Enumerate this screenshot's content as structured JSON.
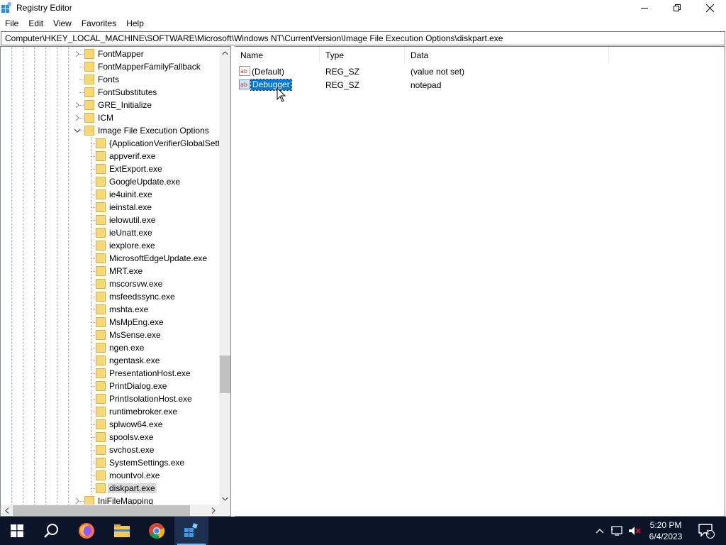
{
  "window": {
    "title": "Registry Editor",
    "controls": {
      "minimize": "minimize",
      "maximize": "maximize",
      "close": "close"
    }
  },
  "menu": [
    "File",
    "Edit",
    "View",
    "Favorites",
    "Help"
  ],
  "address": "Computer\\HKEY_LOCAL_MACHINE\\SOFTWARE\\Microsoft\\Windows NT\\CurrentVersion\\Image File Execution Options\\diskpart.exe",
  "tree": {
    "nodes": [
      {
        "label": "FontMapper",
        "level": 1,
        "expander": "collapsed"
      },
      {
        "label": "FontMapperFamilyFallback",
        "level": 1,
        "expander": "none"
      },
      {
        "label": "Fonts",
        "level": 1,
        "expander": "none"
      },
      {
        "label": "FontSubstitutes",
        "level": 1,
        "expander": "none"
      },
      {
        "label": "GRE_Initialize",
        "level": 1,
        "expander": "collapsed"
      },
      {
        "label": "ICM",
        "level": 1,
        "expander": "collapsed"
      },
      {
        "label": "Image File Execution Options",
        "level": 1,
        "expander": "expanded"
      },
      {
        "label": "{ApplicationVerifierGlobalSett",
        "level": 2,
        "expander": "none"
      },
      {
        "label": "appverif.exe",
        "level": 2,
        "expander": "none"
      },
      {
        "label": "ExtExport.exe",
        "level": 2,
        "expander": "none"
      },
      {
        "label": "GoogleUpdate.exe",
        "level": 2,
        "expander": "none"
      },
      {
        "label": "ie4uinit.exe",
        "level": 2,
        "expander": "none"
      },
      {
        "label": "ieinstal.exe",
        "level": 2,
        "expander": "none"
      },
      {
        "label": "ielowutil.exe",
        "level": 2,
        "expander": "none"
      },
      {
        "label": "ieUnatt.exe",
        "level": 2,
        "expander": "none"
      },
      {
        "label": "iexplore.exe",
        "level": 2,
        "expander": "none"
      },
      {
        "label": "MicrosoftEdgeUpdate.exe",
        "level": 2,
        "expander": "none"
      },
      {
        "label": "MRT.exe",
        "level": 2,
        "expander": "none"
      },
      {
        "label": "mscorsvw.exe",
        "level": 2,
        "expander": "none"
      },
      {
        "label": "msfeedssync.exe",
        "level": 2,
        "expander": "none"
      },
      {
        "label": "mshta.exe",
        "level": 2,
        "expander": "none"
      },
      {
        "label": "MsMpEng.exe",
        "level": 2,
        "expander": "none"
      },
      {
        "label": "MsSense.exe",
        "level": 2,
        "expander": "none"
      },
      {
        "label": "ngen.exe",
        "level": 2,
        "expander": "none"
      },
      {
        "label": "ngentask.exe",
        "level": 2,
        "expander": "none"
      },
      {
        "label": "PresentationHost.exe",
        "level": 2,
        "expander": "none"
      },
      {
        "label": "PrintDialog.exe",
        "level": 2,
        "expander": "none"
      },
      {
        "label": "PrintIsolationHost.exe",
        "level": 2,
        "expander": "none"
      },
      {
        "label": "runtimebroker.exe",
        "level": 2,
        "expander": "none"
      },
      {
        "label": "splwow64.exe",
        "level": 2,
        "expander": "none"
      },
      {
        "label": "spoolsv.exe",
        "level": 2,
        "expander": "none"
      },
      {
        "label": "svchost.exe",
        "level": 2,
        "expander": "none"
      },
      {
        "label": "SystemSettings.exe",
        "level": 2,
        "expander": "none"
      },
      {
        "label": "mountvol.exe",
        "level": 2,
        "expander": "none"
      },
      {
        "label": "diskpart.exe",
        "level": 2,
        "expander": "none",
        "selected": true
      },
      {
        "label": "IniFileMapping",
        "level": 1,
        "expander": "collapsed"
      }
    ]
  },
  "list": {
    "columns": [
      "Name",
      "Type",
      "Data"
    ],
    "rows": [
      {
        "name": "(Default)",
        "type": "REG_SZ",
        "data": "(value not set)",
        "icon": "string-value-icon",
        "selected": false
      },
      {
        "name": "Debugger",
        "type": "REG_SZ",
        "data": "notepad",
        "icon": "string-value-icon",
        "selected": true
      }
    ]
  },
  "taskbar": {
    "items": [
      "start-icon",
      "search-icon",
      "firefox-icon",
      "file-explorer-icon",
      "chrome-icon",
      "registry-editor-icon"
    ],
    "active": "registry-editor-icon",
    "clock_time": "5:20 PM",
    "clock_date": "6/4/2023",
    "notification_count": "1"
  },
  "colors": {
    "selection": "#0078d7",
    "taskbar": "#0b1428",
    "folder": "#f8d775"
  }
}
